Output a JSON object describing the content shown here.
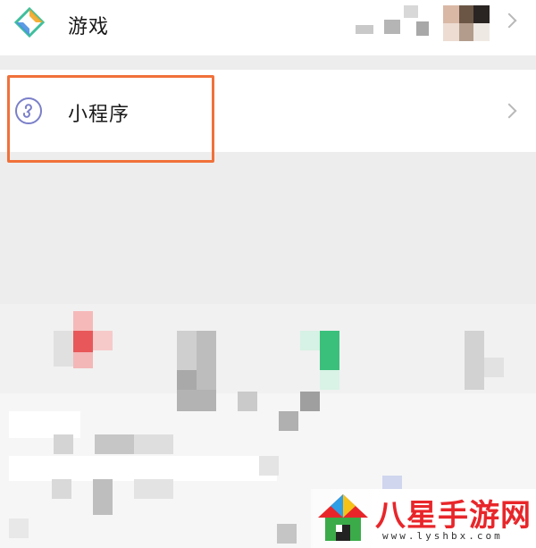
{
  "menu": {
    "games": {
      "label": "游戏",
      "icon": "game-diamond-icon"
    },
    "mini_programs": {
      "label": "小程序",
      "icon": "mini-program-icon"
    }
  },
  "highlight_color": "#f0713a",
  "watermark": {
    "title": "八星手游网",
    "url": "www.lyshbx.com",
    "logo": "house-logo"
  }
}
